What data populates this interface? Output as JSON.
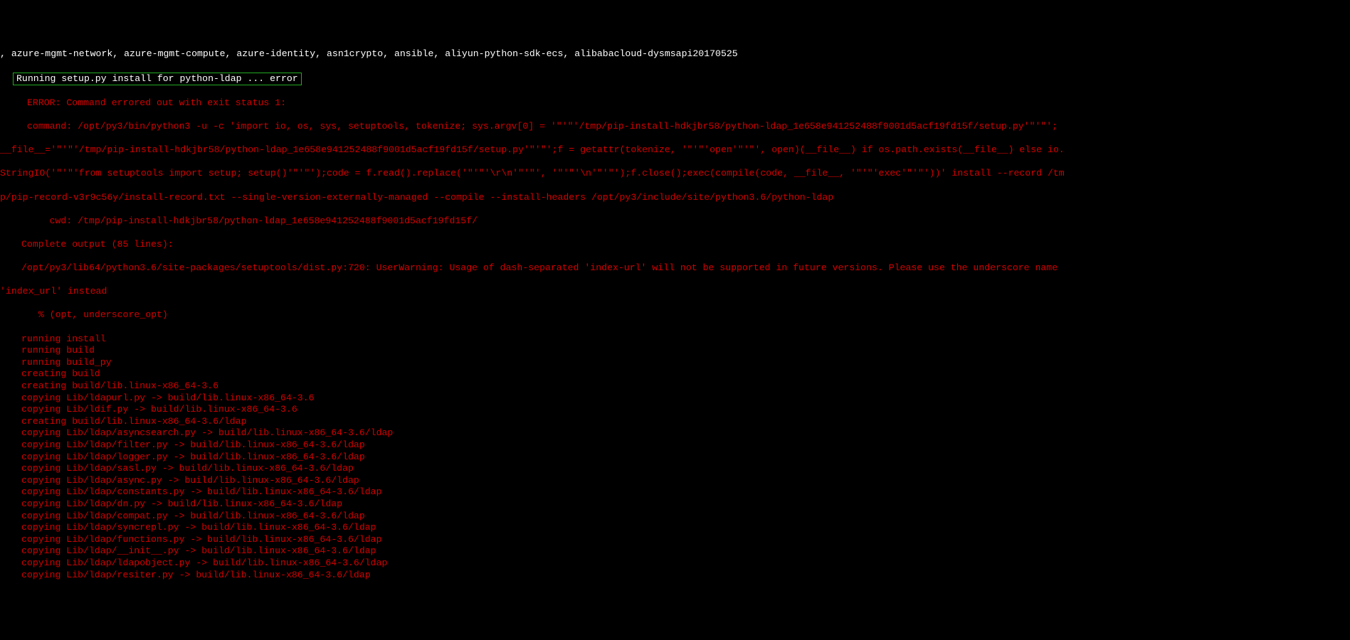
{
  "pkgline": ", azure-mgmt-network, azure-mgmt-compute, azure-identity, asn1crypto, ansible, aliyun-python-sdk-ecs, alibabacloud-dysmsapi20170525",
  "boxed": "Running setup.py install for python-ldap ... error",
  "err_header": "ERROR: Command errored out with exit status 1:",
  "cmd1": " command: /opt/py3/bin/python3 -u -c 'import io, os, sys, setuptools, tokenize; sys.argv[0] = '\"'\"'/tmp/pip-install-hdkjbr58/python-ldap_1e658e941252488f9001d5acf19fd15f/setup.py'\"'\"';",
  "cmd2": "__file__='\"'\"'/tmp/pip-install-hdkjbr58/python-ldap_1e658e941252488f9001d5acf19fd15f/setup.py'\"'\"';f = getattr(tokenize, '\"'\"'open'\"'\"', open)(__file__) if os.path.exists(__file__) else io.",
  "cmd3": "StringIO('\"'\"'from setuptools import setup; setup()'\"'\"');code = f.read().replace('\"'\"'\\r\\n'\"'\"', '\"'\"'\\n'\"'\"');f.close();exec(compile(code, __file__, '\"'\"'exec'\"'\"'))' install --record /tm",
  "cmd4": "p/pip-record-v3r9c56y/install-record.txt --single-version-externally-managed --compile --install-headers /opt/py3/include/site/python3.6/python-ldap",
  "cwd": "     cwd: /tmp/pip-install-hdkjbr58/python-ldap_1e658e941252488f9001d5acf19fd15f/",
  "co1": "Complete output (85 lines):",
  "co2": "/opt/py3/lib64/python3.6/site-packages/setuptools/dist.py:720: UserWarning: Usage of dash-separated 'index-url' will not be supported in future versions. Please use the underscore name ",
  "co3": "'index_url' instead",
  "co4": "  % (opt, underscore_opt)",
  "s": [
    "running install",
    "running build",
    "running build_py",
    "creating build",
    "creating build/lib.linux-x86_64-3.6",
    "copying Lib/ldapurl.py -> build/lib.linux-x86_64-3.6",
    "copying Lib/ldif.py -> build/lib.linux-x86_64-3.6",
    "creating build/lib.linux-x86_64-3.6/ldap",
    "copying Lib/ldap/asyncsearch.py -> build/lib.linux-x86_64-3.6/ldap",
    "copying Lib/ldap/filter.py -> build/lib.linux-x86_64-3.6/ldap",
    "copying Lib/ldap/logger.py -> build/lib.linux-x86_64-3.6/ldap",
    "copying Lib/ldap/sasl.py -> build/lib.linux-x86_64-3.6/ldap",
    "copying Lib/ldap/async.py -> build/lib.linux-x86_64-3.6/ldap",
    "copying Lib/ldap/constants.py -> build/lib.linux-x86_64-3.6/ldap",
    "copying Lib/ldap/dn.py -> build/lib.linux-x86_64-3.6/ldap",
    "copying Lib/ldap/compat.py -> build/lib.linux-x86_64-3.6/ldap",
    "copying Lib/ldap/syncrepl.py -> build/lib.linux-x86_64-3.6/ldap",
    "copying Lib/ldap/functions.py -> build/lib.linux-x86_64-3.6/ldap",
    "copying Lib/ldap/__init__.py -> build/lib.linux-x86_64-3.6/ldap",
    "copying Lib/ldap/ldapobject.py -> build/lib.linux-x86_64-3.6/ldap",
    "copying Lib/ldap/resiter.py -> build/lib.linux-x86_64-3.6/ldap"
  ]
}
